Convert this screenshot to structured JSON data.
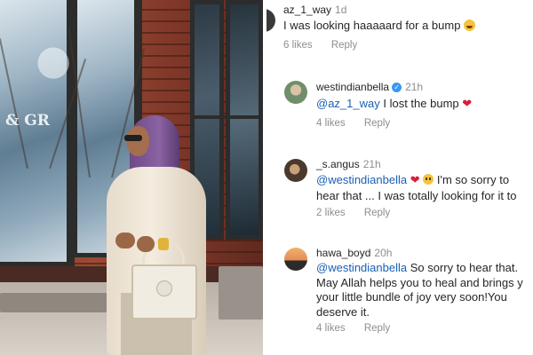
{
  "comments": [
    {
      "username": "az_1_way",
      "time": "1d",
      "text": "I was looking haaaaard for a bump",
      "emoji": "laughing-emoji",
      "likes": "6 likes",
      "reply": "Reply"
    },
    {
      "username": "westindianbella",
      "verified": true,
      "time": "21h",
      "mention": "@az_1_way",
      "text": " I lost the bump",
      "emoji": "broken-heart-emoji",
      "likes": "4 likes",
      "reply": "Reply"
    },
    {
      "username": "_s.angus",
      "time": "21h",
      "mention": "@westindianbella",
      "text_after_emoji": " I'm so sorry to",
      "line2": "hear that ... I was totally looking for it to",
      "likes": "2 likes",
      "reply": "Reply"
    },
    {
      "username": "hawa_boyd",
      "time": "20h",
      "mention": "@westindianbella",
      "text": " So sorry to hear that.",
      "line2": "May Allah helps you to heal and brings y",
      "line3": "your little bundle of joy very soon!You",
      "line4": "deserve it.",
      "likes": "4 likes",
      "reply": "Reply"
    }
  ],
  "photo": {
    "window_text": "& GR",
    "icon": "woman-with-handbag-photo"
  },
  "colors": {
    "text": "#262626",
    "muted": "#8e8e8e",
    "mention": "#1a5fb4",
    "verified": "#3897f0",
    "heart": "#d81f3b"
  }
}
